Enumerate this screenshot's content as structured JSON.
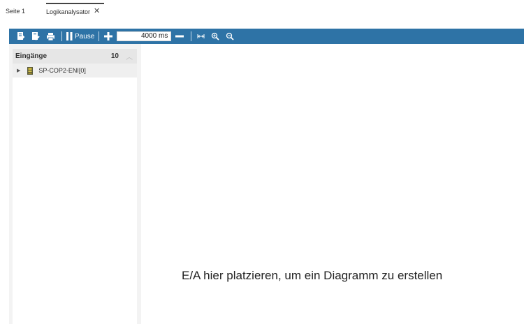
{
  "tabs": [
    {
      "label": "Seite 1",
      "active": false
    },
    {
      "label": "Logikanalysator",
      "active": true,
      "close_icon": "close-icon"
    }
  ],
  "toolbar": {
    "pause_label": "Pause",
    "time_value": "4000 ms",
    "icons": [
      "add-input-icon",
      "edit-input-icon",
      "print-icon",
      "pause-icon",
      "plus-icon",
      "minus-icon",
      "fit-width-icon",
      "zoom-in-icon",
      "zoom-out-icon"
    ],
    "background_color": "#2e73a6"
  },
  "inputs_panel": {
    "title": "Eingänge",
    "count": "10",
    "items": [
      {
        "label": "SP-COP2-ENI[0]",
        "icon": "device-icon"
      }
    ]
  },
  "drop_area": {
    "hint": "E/A hier platzieren, um ein Diagramm zu erstellen"
  }
}
